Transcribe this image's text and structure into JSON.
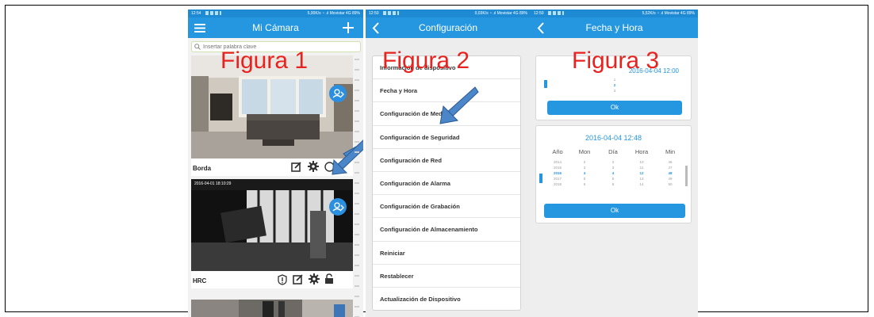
{
  "figures": [
    "Figura 1",
    "Figura 2",
    "Figura 3"
  ],
  "phone1": {
    "status_time": "12:54",
    "status_right": "5,00K/s  ◔  .ıl  Movistar 4G  89%",
    "title": "Mi Cámara",
    "search_placeholder": "Insertar palabra clave",
    "cameras": [
      {
        "label": "Borda"
      },
      {
        "label": "HRC",
        "overlay_time": "2016-04-01  18:10:29"
      }
    ]
  },
  "phone2": {
    "status_time": "12:50",
    "status_right": "0,03K/s  ◔  .ıl  Movistar 4G  89%",
    "title": "Configuración",
    "items": [
      "Información de dispositivo",
      "Fecha y Hora",
      "Configuración de Medios",
      "Configuración de Seguridad",
      "Configuración de Red",
      "Configuración de Alarma",
      "Configuración de Grabación",
      "Configuración de Almacenamiento",
      "Reiniciar",
      "Restablecer",
      "Actualización de Dispositivo"
    ]
  },
  "phone3": {
    "status_time": "12:50",
    "status_right": "5,52K/s  ◔  .ıl  Movistar 4G  89%",
    "title": "Fecha y Hora",
    "top_values": [
      "1",
      "2",
      "3"
    ],
    "top_date": "2016-04-04 12:00",
    "ok_label": "Ok",
    "date_time": "2016-04-04 12:48",
    "columns": [
      "Año",
      "Mon",
      "Día",
      "Hora",
      "Min"
    ],
    "year_values": [
      "2014",
      "2015",
      "2016",
      "2017",
      "2018"
    ],
    "month_values": [
      "2",
      "3",
      "4",
      "5",
      "6"
    ],
    "day_values": [
      "2",
      "3",
      "4",
      "5",
      "6"
    ],
    "hour_values": [
      "10",
      "11",
      "12",
      "13",
      "14"
    ],
    "minute_values": [
      "46",
      "47",
      "48",
      "49",
      "50"
    ]
  },
  "colors": {
    "primary": "#2597e1",
    "figure_label": "#e8231f",
    "arrow": "#4a86c8"
  },
  "icons": [
    "menu-icon",
    "plus-icon",
    "back-icon",
    "search-icon",
    "gear-icon",
    "edit-icon",
    "lock-icon",
    "alert-icon",
    "share-icon"
  ]
}
